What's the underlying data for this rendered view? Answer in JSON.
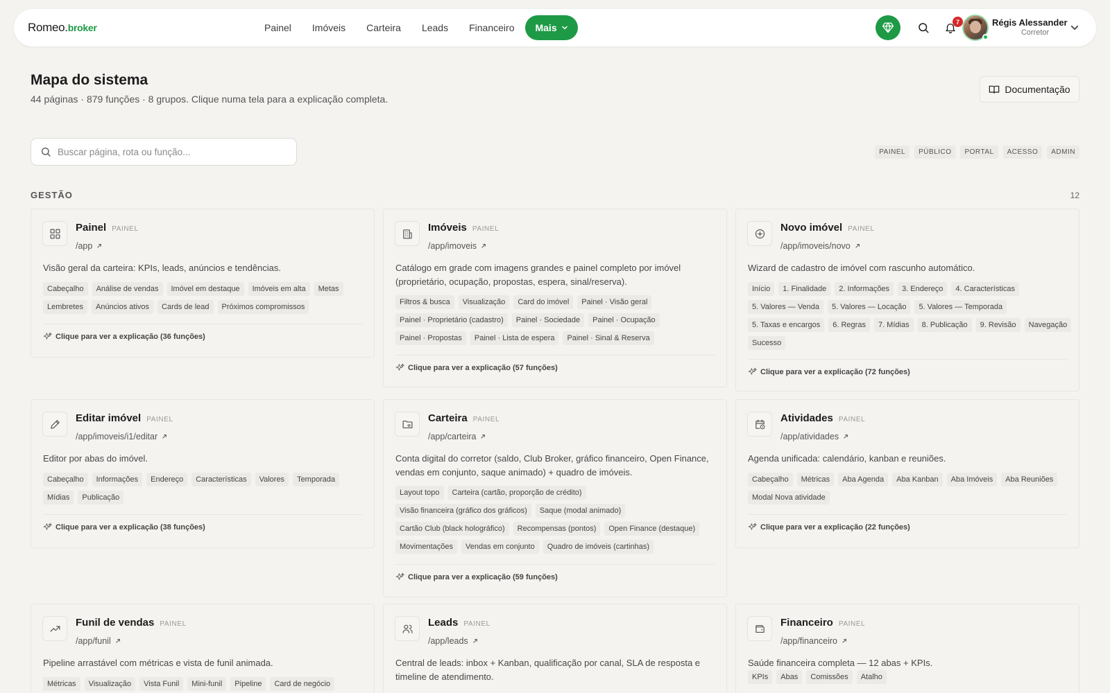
{
  "brand": {
    "name": "Romeo.",
    "suffix": "broker"
  },
  "nav": {
    "links": [
      "Painel",
      "Imóveis",
      "Carteira",
      "Leads",
      "Financeiro"
    ],
    "more_label": "Mais",
    "notifications_count": "7",
    "user_name": "Régis Alessander",
    "user_role": "Corretor"
  },
  "page": {
    "title": "Mapa do sistema",
    "subtitle": "44 páginas · 879 funções · 8 grupos. Clique numa tela para a explicação completa.",
    "doc_label": "Documentação",
    "search_placeholder": "Buscar página, rota ou função...",
    "filters": [
      "PAINEL",
      "PÚBLICO",
      "PORTAL",
      "ACESSO",
      "ADMIN"
    ]
  },
  "section": {
    "title": "GESTÃO",
    "count": "12"
  },
  "cards": [
    {
      "icon": "grid-icon",
      "title": "Painel",
      "tag": "PAINEL",
      "route": "/app",
      "desc": "Visão geral da carteira: KPIs, leads, anúncios e tendências.",
      "chips": [
        "Cabeçalho",
        "Análise de vendas",
        "Imóvel em destaque",
        "Imóveis em alta",
        "Metas",
        "Lembretes",
        "Anúncios ativos",
        "Cards de lead",
        "Próximos compromissos"
      ],
      "footer": "Clique para ver a explicação (36 funções)"
    },
    {
      "icon": "building-icon",
      "title": "Imóveis",
      "tag": "PAINEL",
      "route": "/app/imoveis",
      "desc": "Catálogo em grade com imagens grandes e painel completo por imóvel (proprietário, ocupação, propostas, espera, sinal/reserva).",
      "chips": [
        "Filtros & busca",
        "Visualização",
        "Card do imóvel",
        "Painel · Visão geral",
        "Painel · Proprietário (cadastro)",
        "Painel · Sociedade",
        "Painel · Ocupação",
        "Painel · Propostas",
        "Painel · Lista de espera",
        "Painel · Sinal & Reserva"
      ],
      "footer": "Clique para ver a explicação (57 funções)"
    },
    {
      "icon": "plus-circle-icon",
      "title": "Novo imóvel",
      "tag": "PAINEL",
      "route": "/app/imoveis/novo",
      "desc": "Wizard de cadastro de imóvel com rascunho automático.",
      "chips": [
        "Início",
        "1. Finalidade",
        "2. Informações",
        "3. Endereço",
        "4. Características",
        "5. Valores — Venda",
        "5. Valores — Locação",
        "5. Valores — Temporada",
        "5. Taxas e encargos",
        "6. Regras",
        "7. Mídias",
        "8. Publicação",
        "9. Revisão",
        "Navegação",
        "Sucesso"
      ],
      "footer": "Clique para ver a explicação (72 funções)"
    },
    {
      "icon": "pencil-icon",
      "title": "Editar imóvel",
      "tag": "PAINEL",
      "route": "/app/imoveis/i1/editar",
      "desc": "Editor por abas do imóvel.",
      "chips": [
        "Cabeçalho",
        "Informações",
        "Endereço",
        "Características",
        "Valores",
        "Temporada",
        "Mídias",
        "Publicação"
      ],
      "footer": "Clique para ver a explicação (38 funções)"
    },
    {
      "icon": "folder-heart-icon",
      "title": "Carteira",
      "tag": "PAINEL",
      "route": "/app/carteira",
      "desc": "Conta digital do corretor (saldo, Club Broker, gráfico financeiro, Open Finance, vendas em conjunto, saque animado) + quadro de imóveis.",
      "chips": [
        "Layout topo",
        "Carteira (cartão, proporção de crédito)",
        "Visão financeira (gráfico dos gráficos)",
        "Saque (modal animado)",
        "Cartão Club (black holográfico)",
        "Recompensas (pontos)",
        "Open Finance (destaque)",
        "Movimentações",
        "Vendas em conjunto",
        "Quadro de imóveis (cartinhas)"
      ],
      "footer": "Clique para ver a explicação (59 funções)"
    },
    {
      "icon": "calendar-clock-icon",
      "title": "Atividades",
      "tag": "PAINEL",
      "route": "/app/atividades",
      "desc": "Agenda unificada: calendário, kanban e reuniões.",
      "chips": [
        "Cabeçalho",
        "Métricas",
        "Aba Agenda",
        "Aba Kanban",
        "Aba Imóveis",
        "Aba Reuniões",
        "Modal Nova atividade"
      ],
      "footer": "Clique para ver a explicação (22 funções)"
    },
    {
      "icon": "trending-up-icon",
      "title": "Funil de vendas",
      "tag": "PAINEL",
      "route": "/app/funil",
      "desc": "Pipeline arrastável com métricas e vista de funil animada.",
      "chips": [
        "Métricas",
        "Visualização",
        "Vista Funil",
        "Mini-funil",
        "Pipeline",
        "Card de negócio"
      ],
      "footer": ""
    },
    {
      "icon": "users-icon",
      "title": "Leads",
      "tag": "PAINEL",
      "route": "/app/leads",
      "desc": "Central de leads: inbox + Kanban, qualificação por canal, SLA de resposta e timeline de atendimento.",
      "chips": [],
      "footer": ""
    },
    {
      "icon": "wallet-icon",
      "title": "Financeiro",
      "tag": "PAINEL",
      "route": "/app/financeiro",
      "desc": "Saúde financeira completa — 12 abas + KPIs.",
      "chips": [
        "KPIs",
        "Abas",
        "Comissões",
        "Atalho"
      ],
      "footer": ""
    }
  ]
}
